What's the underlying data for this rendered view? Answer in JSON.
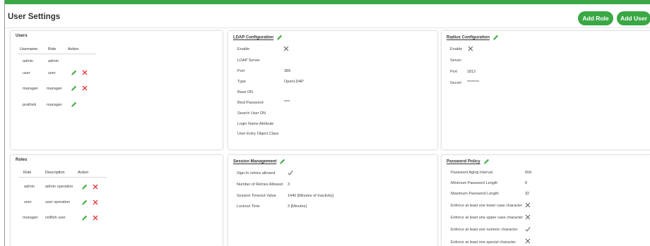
{
  "header": {
    "title": "User Settings",
    "add_role": "Add Role",
    "add_user": "Add User"
  },
  "users": {
    "title": "Users",
    "columns": [
      "Username",
      "Role",
      "Action"
    ],
    "rows": [
      {
        "username": "admin",
        "role": "admin"
      },
      {
        "username": "user",
        "role": "user"
      },
      {
        "username": "manager",
        "role": "manager"
      },
      {
        "username": "prathvik",
        "role": "manager"
      }
    ]
  },
  "ldap": {
    "title": "LDAP Configuration",
    "fields": [
      {
        "label": "Enable",
        "value": ""
      },
      {
        "label": "LDAP Server",
        "value": ""
      },
      {
        "label": "Port",
        "value": "389"
      },
      {
        "label": "Type",
        "value": "OpenLDAP"
      },
      {
        "label": "Base DN",
        "value": ""
      },
      {
        "label": "Bind Password",
        "value": "****"
      },
      {
        "label": "Search User DN",
        "value": ""
      },
      {
        "label": "Login Name Attribute",
        "value": ""
      },
      {
        "label": "User Entry Object Class",
        "value": ""
      }
    ]
  },
  "radius": {
    "title": "Radius Configuration",
    "fields": [
      {
        "label": "Enable",
        "value": ""
      },
      {
        "label": "Server",
        "value": ""
      },
      {
        "label": "Port",
        "value": "1812"
      },
      {
        "label": "Secret",
        "value": "********"
      }
    ]
  },
  "roles": {
    "title": "Roles",
    "columns": [
      "Role",
      "Description",
      "Action"
    ],
    "rows": [
      {
        "role": "admin",
        "description": "admin operation"
      },
      {
        "role": "user",
        "description": "user operation"
      },
      {
        "role": "manager",
        "description": "redfish user"
      }
    ]
  },
  "session": {
    "title": "Session Management",
    "fields": [
      {
        "label": "Sign-In retries allowed",
        "value": ""
      },
      {
        "label": "Number of Retries Allowed",
        "value": "3"
      },
      {
        "label": "Session Timeout Value",
        "value": "1440  [Minutes of Inactivity]"
      },
      {
        "label": "Lockout Time",
        "value": "3  [Minutes]"
      }
    ]
  },
  "policy": {
    "title": "Password Policy",
    "fields": [
      {
        "label": "Password Aging Interval",
        "value": "60d"
      },
      {
        "label": "Minimum Password Length",
        "value": "8"
      },
      {
        "label": "Maximum Password Length",
        "value": "32"
      },
      {
        "label": "Enforce at least one lower case character",
        "value": ""
      },
      {
        "label": "Enforce at least one upper case character",
        "value": ""
      },
      {
        "label": "Enforce at least one numeric character",
        "value": ""
      },
      {
        "label": "Enforce at least one special character",
        "value": ""
      }
    ]
  },
  "colors": {
    "accent": "#3aa845",
    "delete": "#e0393e"
  }
}
